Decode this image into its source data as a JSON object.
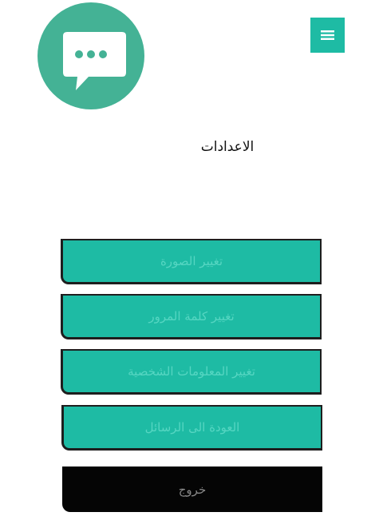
{
  "header": {
    "logo_icon": "chat-bubble-dots-icon",
    "menu_icon": "hamburger-menu-icon",
    "brand_color": "#44b295",
    "accent_color": "#1ebba4"
  },
  "page": {
    "title": "الاعدادات"
  },
  "settings": {
    "change_photo": "تغيير الصورة",
    "change_password": "تغيير كلمة المرور",
    "change_personal_info": "تغيير المعلومات الشخصية",
    "back_to_messages": "العودة الى الرسائل",
    "logout": "خروج"
  }
}
